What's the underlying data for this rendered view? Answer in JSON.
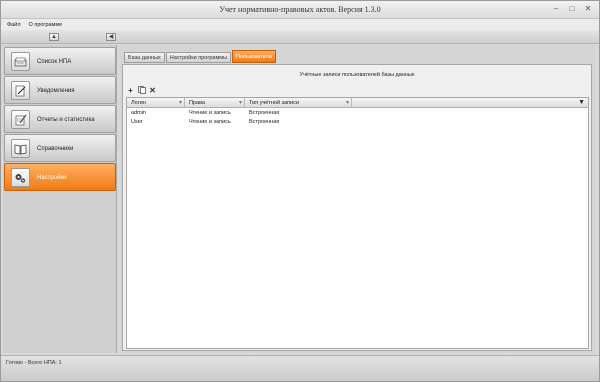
{
  "window": {
    "title": "Учет нормативно-правовых актов. Версия 1.3.0"
  },
  "menu": {
    "items": [
      "Файл",
      "О программе"
    ]
  },
  "sidebar": {
    "items": [
      {
        "label": "Список НПА",
        "icon": "document-stack-icon",
        "active": false
      },
      {
        "label": "Уведомления",
        "icon": "pen-icon",
        "active": false
      },
      {
        "label": "Отчеты и статистика",
        "icon": "report-icon",
        "active": false
      },
      {
        "label": "Справочники",
        "icon": "book-icon",
        "active": false
      },
      {
        "label": "Настройки",
        "icon": "gears-icon",
        "active": true
      }
    ]
  },
  "tabs": [
    {
      "label": "База данных",
      "active": false
    },
    {
      "label": "Настройки программы",
      "active": false
    },
    {
      "label": "Пользователи",
      "active": true
    }
  ],
  "panel": {
    "title": "Учётные записи пользователей базы данных",
    "tools": [
      "add-icon",
      "copy-icon",
      "delete-icon"
    ]
  },
  "grid": {
    "columns": [
      "Логин",
      "Права",
      "Тип учётной записи"
    ],
    "rows": [
      [
        "admin",
        "Чтение и запись",
        "Встроенная"
      ],
      [
        "User",
        "Чтение и запись",
        "Встроенная"
      ]
    ]
  },
  "status": {
    "text": "Готово - Всего НПА: 1"
  },
  "colors": {
    "accent": "#f07a14",
    "window_bg": "#d8d8d8"
  }
}
